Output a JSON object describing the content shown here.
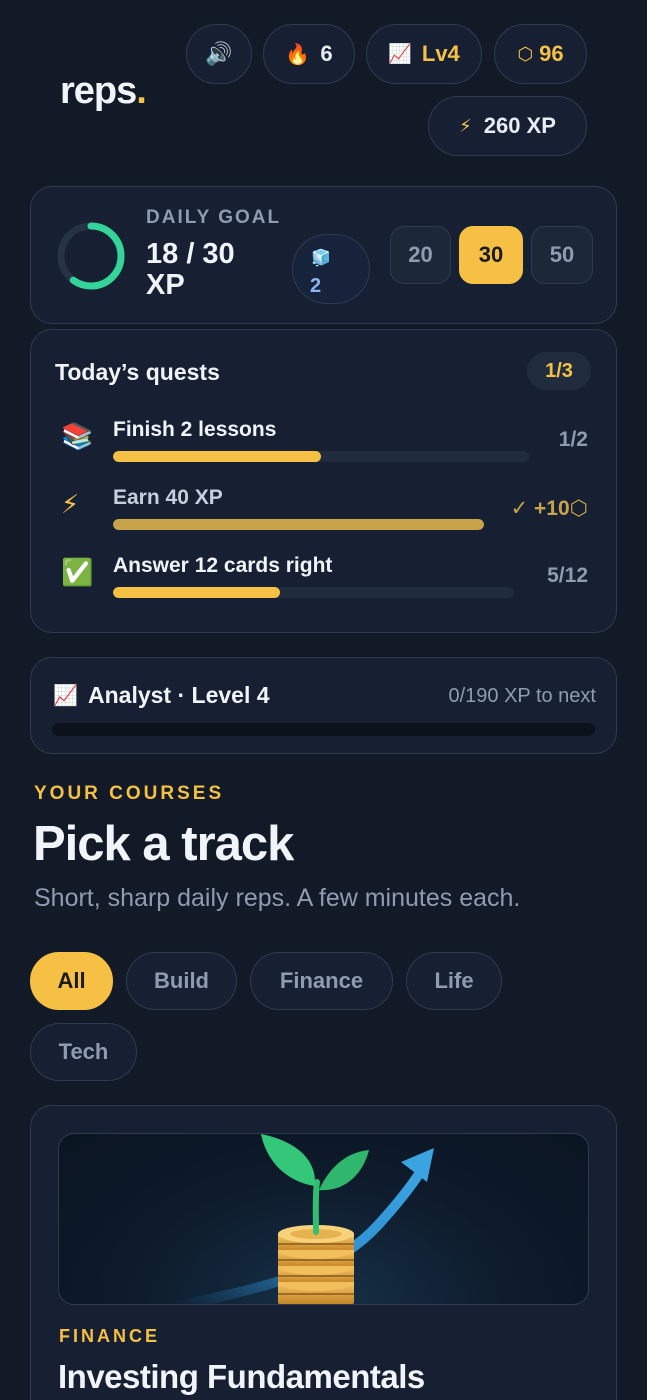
{
  "header": {
    "logo_text": "reps",
    "logo_dot": ".",
    "sound_icon": "speaker-icon",
    "streak": {
      "icon": "flame-icon",
      "value": "6"
    },
    "level": {
      "icon": "chart-icon",
      "value": "Lv4"
    },
    "coins": {
      "icon": "hexagon-coin-icon",
      "value": "96"
    },
    "xp": {
      "icon": "lightning-icon",
      "value": "260 XP"
    }
  },
  "daily_goal": {
    "label": "DAILY GOAL",
    "value": "18 / 30 XP",
    "progress": 0.6,
    "freeze_icon": "ice-cube-icon",
    "freeze_count": "2",
    "options": [
      "20",
      "30",
      "50"
    ],
    "selected": "30"
  },
  "quests": {
    "title": "Today’s quests",
    "count": "1/3",
    "items": [
      {
        "icon": "📚",
        "name": "Finish 2 lessons",
        "right": "1/2",
        "progress": 0.5
      },
      {
        "icon": "⚡",
        "name": "Earn 40 XP",
        "right": "✓ +10⬡",
        "progress": 1.0
      },
      {
        "icon": "✅",
        "name": "Answer 12 cards right",
        "right": "5/12",
        "progress": 0.4167
      }
    ]
  },
  "level_card": {
    "icon": "chart-icon",
    "title": "Analyst · Level 4",
    "next": "0/190 XP to next",
    "progress": 0
  },
  "courses": {
    "eyebrow": "YOUR COURSES",
    "title": "Pick a track",
    "subtitle": "Short, sharp daily reps. A few minutes each.",
    "filters": [
      "All",
      "Build",
      "Finance",
      "Life",
      "Tech"
    ],
    "active_filter": "All",
    "card": {
      "category": "FINANCE",
      "title": "Investing Fundamentals",
      "image_icon": "sprout-coins-growth-icon"
    }
  },
  "colors": {
    "accent": "#f5c044",
    "background": "#121a27",
    "card": "#162032",
    "ring": "#34d399"
  }
}
